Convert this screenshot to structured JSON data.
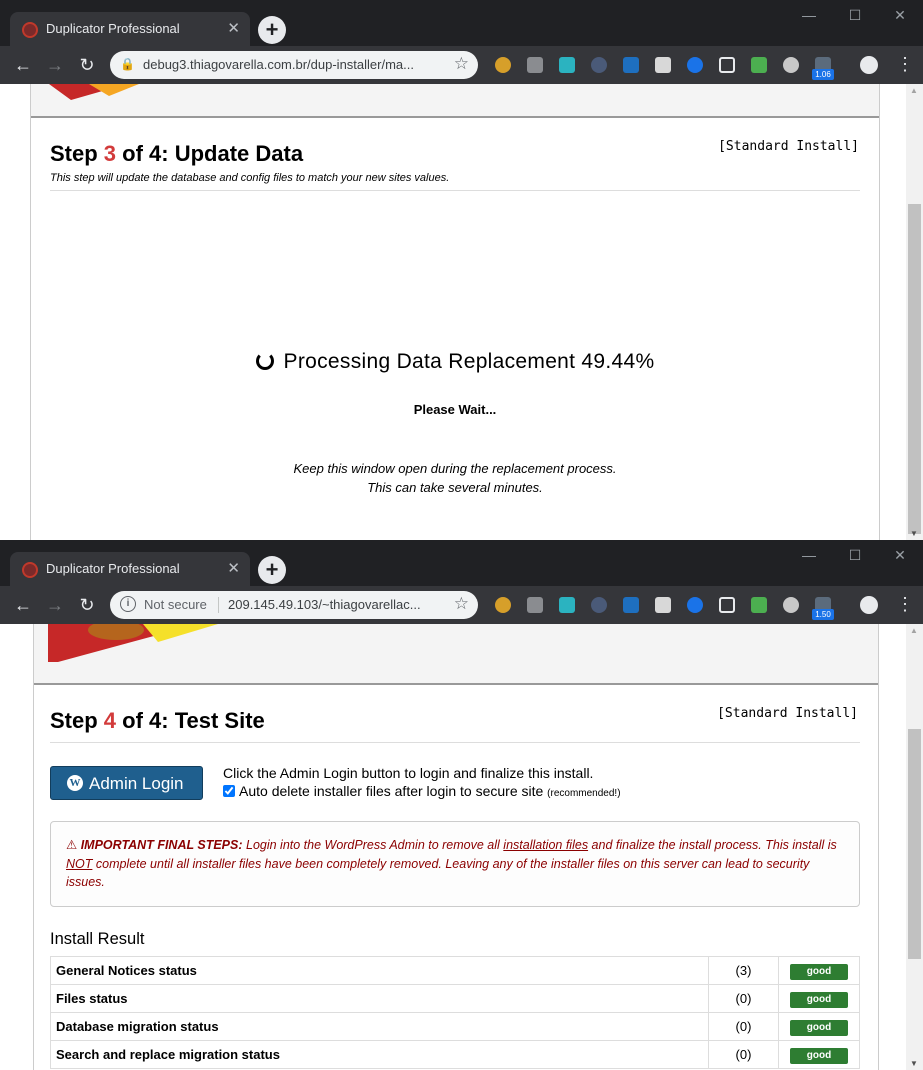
{
  "colors": {
    "accent_red": "#d23b3b",
    "button_blue": "#1f5f8e",
    "good_green": "#2e7d32",
    "warning_red": "#8b0000"
  },
  "window1": {
    "tab_title": "Duplicator Professional",
    "tab_close": "✕",
    "url": "debug3.thiagovarella.com.br/dup-installer/ma...",
    "extension_badge": "1.06",
    "step": {
      "prefix": "Step ",
      "number": "3",
      "suffix": " of 4: Update Data"
    },
    "install_mode": "[Standard Install]",
    "subtitle": "This step will update the database and config files to match your new sites values.",
    "progress_text": "Processing Data Replacement 49.44%",
    "please_wait": "Please Wait...",
    "keep_open_1": "Keep this window open during the replacement process.",
    "keep_open_2": "This can take several minutes."
  },
  "window2": {
    "tab_title": "Duplicator Professional",
    "tab_close": "✕",
    "security": "Not secure",
    "url": "209.145.49.103/~thiagovarellac...",
    "extension_badge": "1.50",
    "step": {
      "prefix": "Step ",
      "number": "4",
      "suffix": " of 4: Test Site"
    },
    "install_mode": "[Standard Install]",
    "admin_login_label": "Admin Login",
    "login_instruction": "Click the Admin Login button to login and finalize this install.",
    "auto_delete_label": "Auto delete installer files after login to secure site",
    "auto_delete_note": "(recommended!)",
    "auto_delete_checked": true,
    "final_steps": {
      "heading": "IMPORTANT FINAL STEPS:",
      "text_a": " Login into the WordPress Admin to remove all ",
      "link": "installation files",
      "text_b": " and finalize the install process. This install is ",
      "not": "NOT",
      "text_c": " complete until all installer files have been completely removed. Leaving any of the installer files on this server can lead to security issues."
    },
    "result_title": "Install Result",
    "results": [
      {
        "name": "General Notices status",
        "count": "(3)",
        "status": "good"
      },
      {
        "name": "Files status",
        "count": "(0)",
        "status": "good"
      },
      {
        "name": "Database migration status",
        "count": "(0)",
        "status": "good"
      },
      {
        "name": "Search and replace migration status",
        "count": "(0)",
        "status": "good"
      }
    ]
  }
}
